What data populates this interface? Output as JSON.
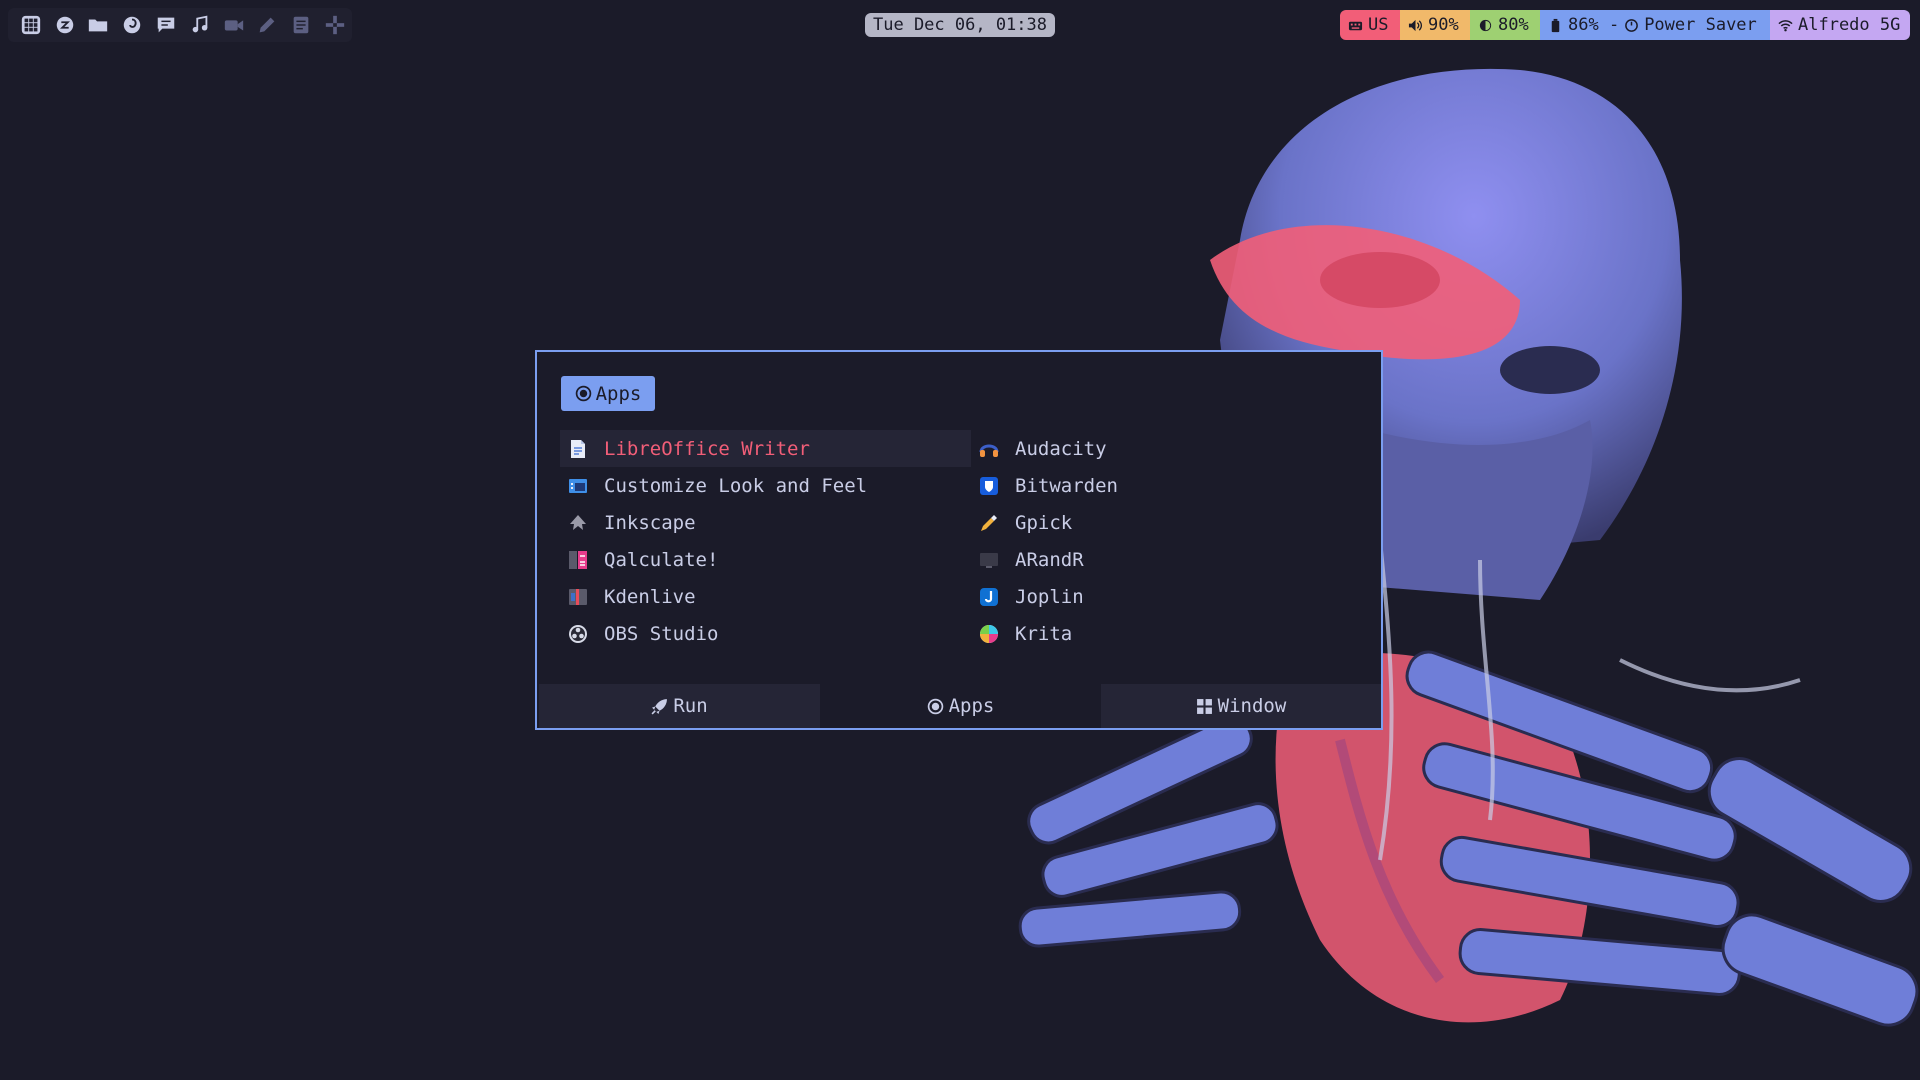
{
  "topbar": {
    "launchers": [
      {
        "icon": "grid-icon"
      },
      {
        "icon": "settings-icon"
      },
      {
        "icon": "folder-icon"
      },
      {
        "icon": "firefox-icon"
      },
      {
        "icon": "chat-icon"
      },
      {
        "icon": "music-icon"
      },
      {
        "icon": "video-camera-icon"
      },
      {
        "icon": "pencil-icon"
      },
      {
        "icon": "document-icon"
      },
      {
        "icon": "gamepad-icon"
      }
    ],
    "clock": "Tue Dec 06, 01:38",
    "status": {
      "keyboard": "US",
      "volume": "90%",
      "brightness": "80%",
      "battery": "86% - ",
      "power_profile": "Power Saver",
      "wifi": "Alfredo 5G"
    }
  },
  "launcher": {
    "mode_label": "Apps",
    "apps": [
      {
        "label": "LibreOffice Writer",
        "icon": "libreoffice-writer-icon",
        "selected": true
      },
      {
        "label": "Audacity",
        "icon": "audacity-icon"
      },
      {
        "label": "Customize Look and Feel",
        "icon": "appearance-icon"
      },
      {
        "label": "Bitwarden",
        "icon": "bitwarden-icon"
      },
      {
        "label": "Inkscape",
        "icon": "inkscape-icon"
      },
      {
        "label": "Gpick",
        "icon": "gpick-icon"
      },
      {
        "label": "Qalculate!",
        "icon": "qalculate-icon"
      },
      {
        "label": "ARandR",
        "icon": "arandr-icon"
      },
      {
        "label": "Kdenlive",
        "icon": "kdenlive-icon"
      },
      {
        "label": "Joplin",
        "icon": "joplin-icon"
      },
      {
        "label": "OBS Studio",
        "icon": "obs-icon"
      },
      {
        "label": "Krita",
        "icon": "krita-icon"
      }
    ],
    "modes": {
      "run": "Run",
      "apps": "Apps",
      "window": "Window"
    }
  },
  "colors": {
    "background": "#1b1b29",
    "accent": "#7b9ef0",
    "selected_text": "#f25e78",
    "red": "#f25e78",
    "yellow": "#f1b96a",
    "green": "#9ed072",
    "blue": "#7b9ef0",
    "purple": "#c4a7f2"
  }
}
